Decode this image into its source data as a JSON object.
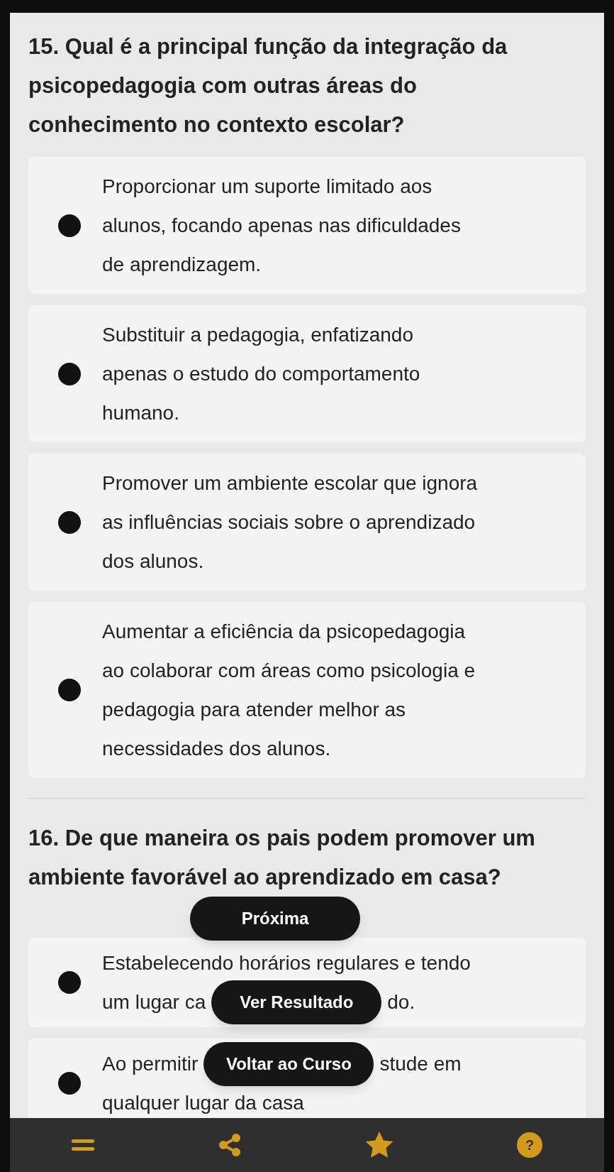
{
  "questions": [
    {
      "title": "15. Qual é a principal função da integração da psicopedagogia com outras áreas do conhecimento no contexto escolar?",
      "options": [
        {
          "lines": [
            {
              "before": "Proporcionar um suporte limitado aos"
            },
            {
              "before": "alunos, focando apenas nas dificuldades"
            },
            {
              "before": "de aprendizagem."
            }
          ]
        },
        {
          "lines": [
            {
              "before": "Substituir a pedagogia, enfatizando"
            },
            {
              "before": "apenas o estudo do comportamento"
            },
            {
              "before": "humano."
            }
          ]
        },
        {
          "lines": [
            {
              "before": "Promover um ambiente escolar que ignora"
            },
            {
              "before": "as influências sociais sobre o aprendizado"
            },
            {
              "before": "dos alunos."
            }
          ]
        },
        {
          "lines": [
            {
              "before": "Aumentar a eficiência da psicopedagogia"
            },
            {
              "before": "ao colaborar com áreas como psicologia e"
            },
            {
              "before": "pedagogia para atender melhor as"
            },
            {
              "before": "necessidades dos alunos."
            }
          ]
        }
      ]
    },
    {
      "title": "16. De que maneira os pais podem promover um ambiente favorável ao aprendizado em casa?",
      "button": "Próxima",
      "options": [
        {
          "lines": [
            {
              "before": "Estabelecendo horários regulares e tendo"
            },
            {
              "before": "um lugar ca",
              "button": "Ver Resultado",
              "after": "do."
            }
          ]
        },
        {
          "lines": [
            {
              "before": "Ao permitir",
              "button": "Voltar ao Curso",
              "after": "stude em"
            },
            {
              "before": "qualquer lugar da casa"
            }
          ]
        }
      ]
    }
  ],
  "nav": [
    {
      "kind": "menu"
    },
    {
      "kind": "share"
    },
    {
      "kind": "star"
    },
    {
      "kind": "help"
    }
  ],
  "help_label": "?"
}
